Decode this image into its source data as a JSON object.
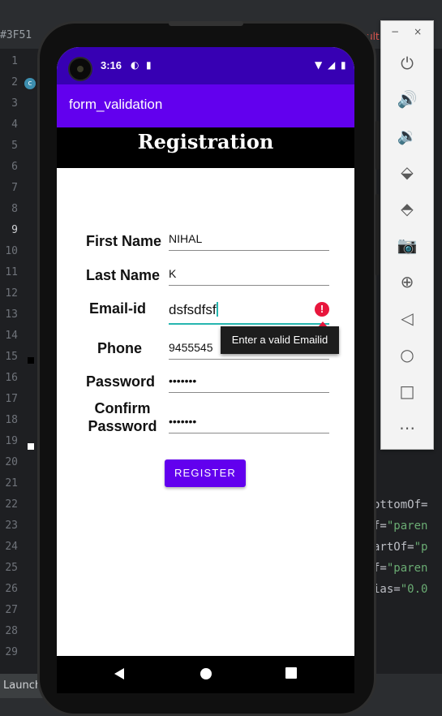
{
  "ide": {
    "search_text": "#3F51",
    "error_text": "ult",
    "line_numbers": [
      "1",
      "2",
      "3",
      "4",
      "5",
      "6",
      "7",
      "8",
      "9",
      "10",
      "11",
      "12",
      "13",
      "14",
      "15",
      "16",
      "17",
      "18",
      "19",
      "20",
      "21",
      "22",
      "23",
      "24",
      "25",
      "26",
      "27",
      "28",
      "29"
    ],
    "active_line": "9",
    "code_lines": [
      {
        "line": "22",
        "attr": "ottomOf=",
        "str": ""
      },
      {
        "line": "23",
        "attr": "f=",
        "str": "\"paren"
      },
      {
        "line": "24",
        "attr": "artOf=",
        "str": "\"p"
      },
      {
        "line": "25",
        "attr": "f=",
        "str": "\"paren"
      },
      {
        "line": "26",
        "attr": "ias=",
        "str": "\"0.0"
      }
    ],
    "launch_label": "Launch"
  },
  "emulator_panel": {
    "minimize": "−",
    "close": "×",
    "buttons": [
      "power-icon",
      "volume-up-icon",
      "volume-down-icon",
      "rotate-left-icon",
      "rotate-right-icon",
      "camera-icon",
      "zoom-icon",
      "back-icon",
      "home-icon",
      "overview-icon",
      "more-icon"
    ]
  },
  "status_bar": {
    "time": "3:16"
  },
  "app": {
    "title": "form_validation",
    "heading": "Registration",
    "fields": [
      {
        "label": "First Name",
        "value": "NIHAL"
      },
      {
        "label": "Last Name",
        "value": "K"
      },
      {
        "label": "Email-id",
        "value": "dsfsdfsf"
      },
      {
        "label": "Phone",
        "value": "9455545"
      },
      {
        "label": "Password",
        "value": "•••••••"
      },
      {
        "label": "Confirm Password",
        "value": "•••••••"
      }
    ],
    "error_tooltip": "Enter a valid Emailid",
    "register_button": "REGISTER"
  },
  "colors": {
    "status_bar": "#3700b3",
    "app_bar": "#6200ee",
    "accent": "#26b6b0",
    "error": "#e8163c"
  }
}
